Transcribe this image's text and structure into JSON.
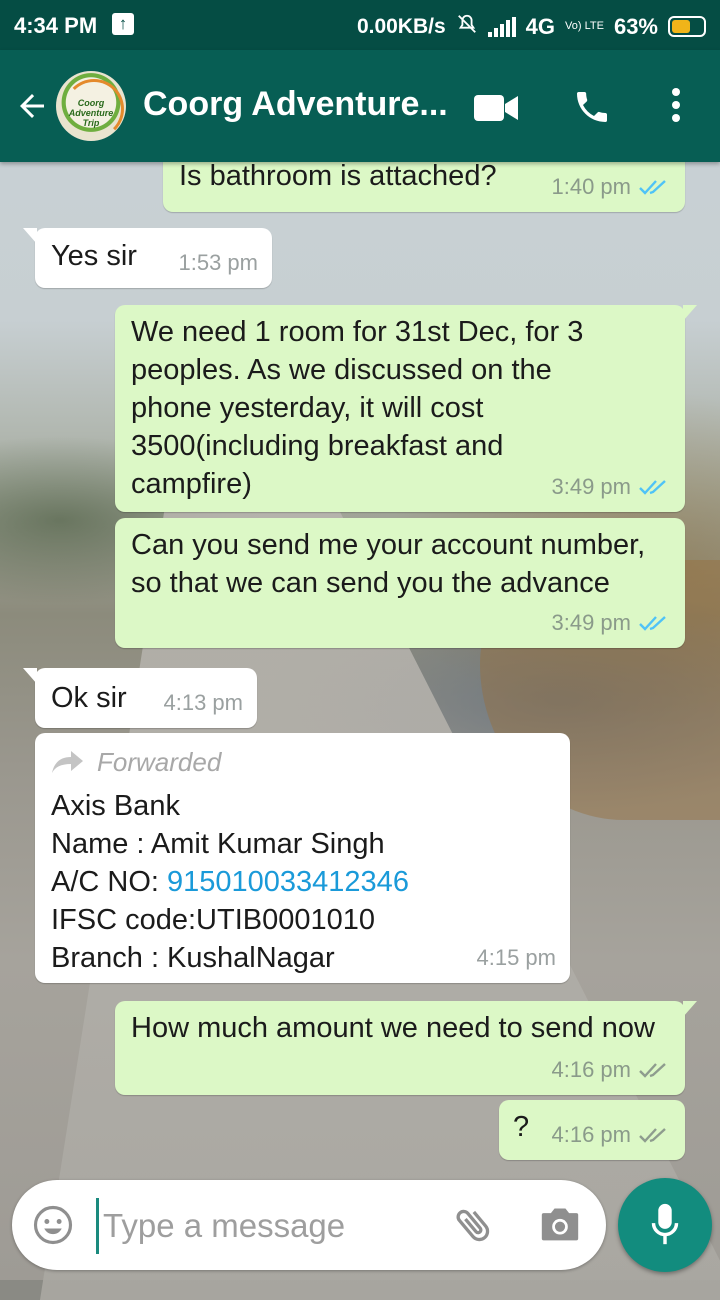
{
  "status_bar": {
    "time": "4:34 PM",
    "net_speed": "0.00KB/s",
    "network": "4G",
    "volte": "Vo) LTE",
    "battery": "63%",
    "battery_level": 0.63
  },
  "toolbar": {
    "title": "Coorg Adventure...",
    "avatar_text": "Coorg Adventure Trip"
  },
  "messages": [
    {
      "dir": "out",
      "text": "Is bathroom is attached?",
      "time": "1:40 pm",
      "ticks": "read"
    },
    {
      "dir": "in",
      "text": "Yes sir",
      "time": "1:53 pm"
    },
    {
      "dir": "out",
      "text": "We need 1 room for 31st Dec, for 3 peoples. As we discussed on the phone yesterday, it will cost 3500(including breakfast and campfire)",
      "time": "3:49 pm",
      "ticks": "read"
    },
    {
      "dir": "out",
      "text": "Can you send me your account number, so that we can send you the advance",
      "time": "3:49 pm",
      "ticks": "read"
    },
    {
      "dir": "in",
      "text": "Ok sir",
      "time": "4:13 pm"
    },
    {
      "dir": "in",
      "forwarded_label": "Forwarded",
      "line1": "Axis Bank",
      "line2": "Name : Amit Kumar Singh",
      "line3_prefix": "A/C NO: ",
      "line3_link": "915010033412346",
      "line4": "IFSC code:UTIB0001010",
      "line5": "Branch : KushalNagar",
      "time": "4:15 pm"
    },
    {
      "dir": "out",
      "text": "How much amount we need to send now",
      "time": "4:16 pm",
      "ticks": "delivered"
    },
    {
      "dir": "out",
      "text": "?",
      "time": "4:16 pm",
      "ticks": "delivered"
    }
  ],
  "input": {
    "placeholder": "Type a message"
  },
  "colors": {
    "header": "#075e54",
    "status_bar": "#054d44",
    "outgoing_bubble": "#dcf8c6",
    "incoming_bubble": "#ffffff",
    "read_ticks": "#4fc3f7",
    "link": "#1a9ad9",
    "fab": "#128c7e"
  }
}
